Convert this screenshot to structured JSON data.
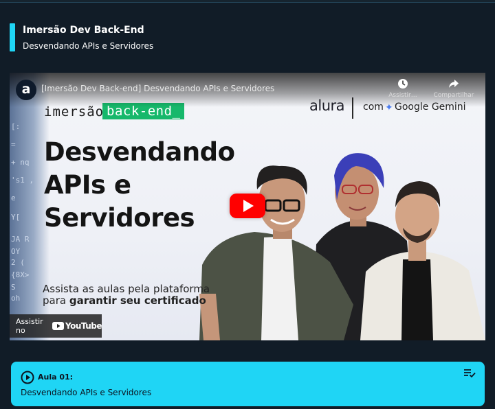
{
  "course": {
    "title": "Imersão Dev Back-End",
    "subtitle": "Desvendando APIs e Servidores",
    "accent_color": "#1fd5f5"
  },
  "player": {
    "channel_avatar": "a",
    "video_title": "[Imersão Dev Back-end] Desvendando APIs e Servidores",
    "actions": [
      {
        "label": "Assistir…",
        "icon": "clock-icon"
      },
      {
        "label": "Compartilhar",
        "icon": "share-icon"
      }
    ],
    "thumbnail": {
      "brand_imersao": "imersão",
      "brand_backend": "back-end_",
      "brand_alura": "alura",
      "brand_com": "com",
      "brand_gemini": "Google Gemini",
      "headline": [
        "Desvendando",
        "APIs e",
        "Servidores"
      ],
      "cta_line1": "Assista as aulas pela plataforma",
      "cta_line2_prefix": "para ",
      "cta_line2_strong": "garantir seu certificado",
      "code_lines": [
        "[:",
        "=",
        "+ nq",
        "'s1 ,",
        "e",
        "Y[",
        "JA R",
        "OY",
        "2 (",
        "{8X>",
        "S",
        "oh"
      ],
      "accent_green": "#16b86b"
    },
    "watch_on_label": "Assistir no",
    "youtube_word": "YouTube",
    "play_color": "#ff0000"
  },
  "lesson": {
    "number_label": "Aula 01:",
    "name": "Desvendando APIs e Servidores",
    "play_icon": "play-circle-icon",
    "playlist_icon": "playlist-check-icon"
  }
}
